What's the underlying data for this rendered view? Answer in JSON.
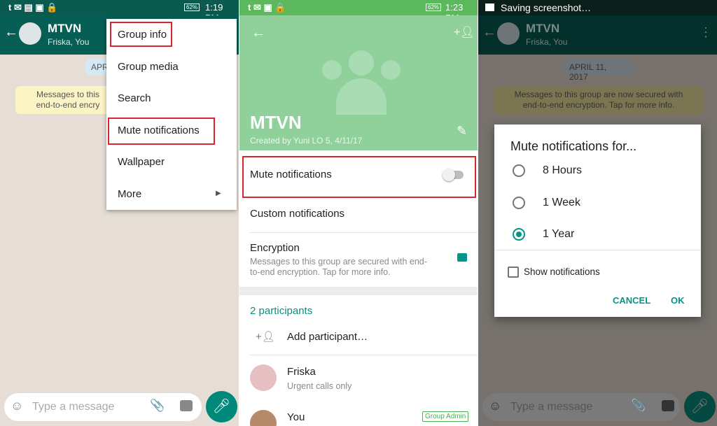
{
  "panel1": {
    "status_time": "1:19 PM",
    "battery": "62%",
    "chat": {
      "title": "MTVN",
      "subtitle": "Friska, You",
      "date_chip": "APR",
      "encryption_line1": "Messages to this",
      "encryption_line2": "end-to-end encry"
    },
    "menu": [
      {
        "label": "Group info",
        "highlighted": true
      },
      {
        "label": "Group media"
      },
      {
        "label": "Search"
      },
      {
        "label": "Mute notifications",
        "highlighted": true
      },
      {
        "label": "Wallpaper"
      },
      {
        "label": "More"
      }
    ],
    "input_placeholder": "Type a message"
  },
  "panel2": {
    "status_time": "1:23 PM",
    "battery": "62%",
    "group_name": "MTVN",
    "created_by": "Created by Yuni LO 5, 4/11/17",
    "mute_label": "Mute notifications",
    "mute_on": false,
    "custom_label": "Custom notifications",
    "encryption_title": "Encryption",
    "encryption_desc1": "Messages to this group are secured with end-",
    "encryption_desc2": "to-end encryption. Tap for more info.",
    "participants_header": "2 participants",
    "add_participant": "Add participant…",
    "participants": [
      {
        "name": "Friska",
        "status": "Urgent calls only"
      },
      {
        "name": "You",
        "badge": "Group Admin"
      }
    ]
  },
  "panel3": {
    "status_text": "Saving screenshot…",
    "chat": {
      "title": "MTVN",
      "subtitle": "Friska, You",
      "date_chip": "APRIL 11, 2017",
      "encryption_line1": "Messages to this group are now secured with",
      "encryption_line2": "end-to-end encryption. Tap for more info."
    },
    "dialog": {
      "title": "Mute notifications for...",
      "options": [
        "8 Hours",
        "1 Week",
        "1 Year"
      ],
      "selected": "1 Year",
      "show_notifications_label": "Show notifications",
      "show_notifications_checked": false,
      "cancel": "CANCEL",
      "ok": "OK"
    },
    "input_placeholder": "Type a message"
  },
  "colors": {
    "header": "#075e54",
    "accent": "#009688",
    "highlight": "#d9232e",
    "mic": "#00897b"
  }
}
